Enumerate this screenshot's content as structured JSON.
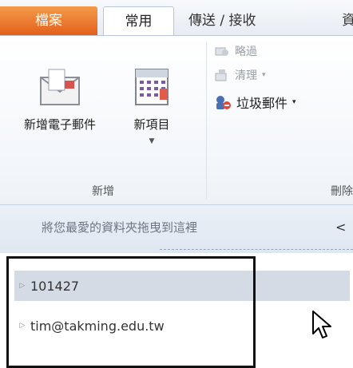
{
  "tabs": {
    "file": "檔案",
    "home": "常用",
    "send_receive": "傳送 / 接收",
    "next_partial": "資"
  },
  "ribbon": {
    "new_group": {
      "label": "新增",
      "new_email": "新增電子郵件",
      "new_items": "新項目"
    },
    "delete_group": {
      "label": "刪除",
      "ignore": "略過",
      "clean_up": "清理",
      "junk": "垃圾郵件"
    }
  },
  "favorites": {
    "hint": "將您最愛的資料夾拖曳到這裡",
    "collapse": "<"
  },
  "folders": [
    {
      "name": "101427"
    },
    {
      "name": "tim@takming.edu.tw"
    }
  ],
  "colors": {
    "file_tab": "#e4601b",
    "selected_row": "#d4dbe5"
  },
  "icons": {
    "new_email": "envelope-icon",
    "new_items": "calendar-icon",
    "ignore": "ignore-icon",
    "clean_up": "clean-up-icon",
    "junk": "junk-mail-icon",
    "expand": "expand-triangle-icon",
    "cursor": "mouse-cursor-icon"
  }
}
